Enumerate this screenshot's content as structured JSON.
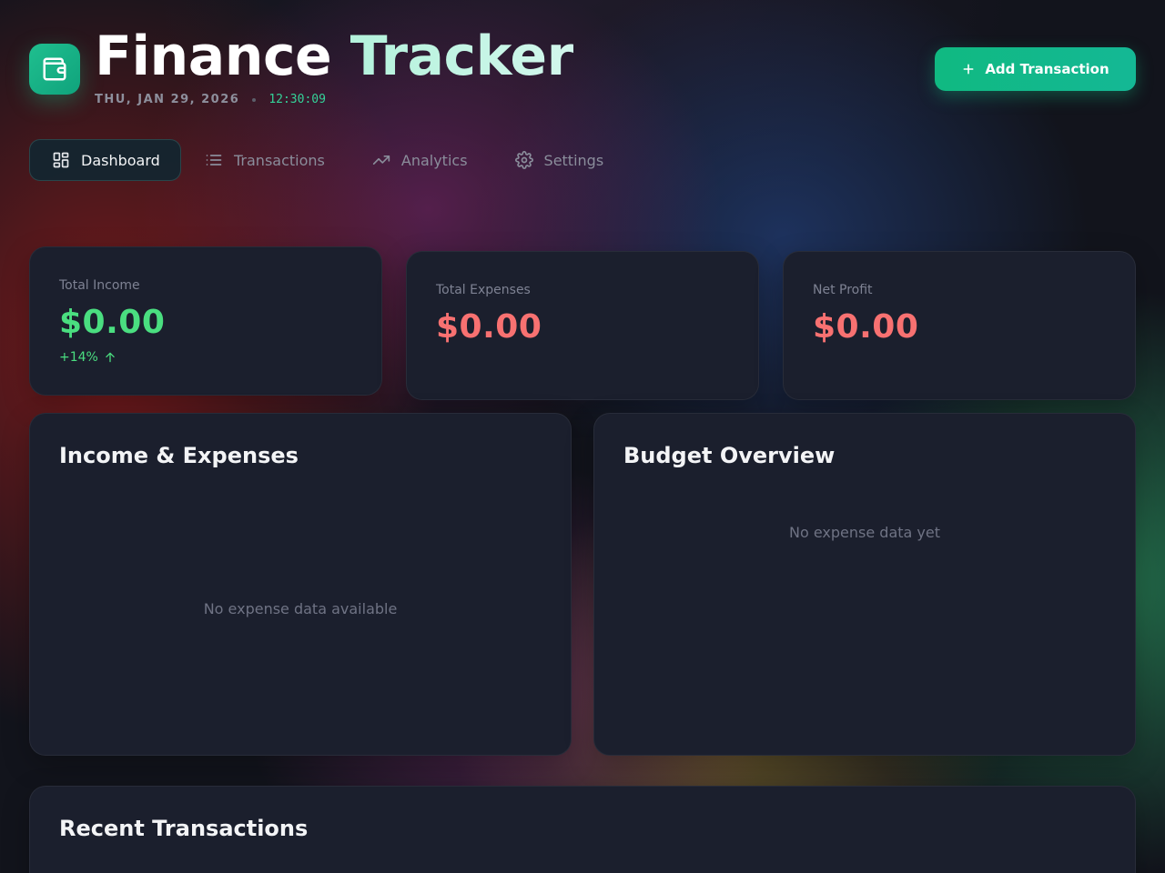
{
  "app": {
    "title_part1": "Finance",
    "title_part2": "Tracker",
    "date": "THU, JAN 29, 2026",
    "time": "12:30:09",
    "logo_icon": "wallet-icon",
    "accent_color": "#10b981"
  },
  "header": {
    "add_button_label": "Add Transaction",
    "add_button_icon": "plus-icon"
  },
  "nav": {
    "items": [
      {
        "label": "Dashboard",
        "icon": "dashboard-icon",
        "active": true
      },
      {
        "label": "Transactions",
        "icon": "list-icon",
        "active": false
      },
      {
        "label": "Analytics",
        "icon": "trending-up-icon",
        "active": false
      },
      {
        "label": "Settings",
        "icon": "gear-icon",
        "active": false
      }
    ]
  },
  "stats": {
    "income": {
      "label": "Total Income",
      "value": "$0.00",
      "trend": "+14%",
      "color": "#4ade80"
    },
    "expenses": {
      "label": "Total Expenses",
      "value": "$0.00",
      "color": "#f87171"
    },
    "profit": {
      "label": "Net Profit",
      "value": "$0.00",
      "color": "#f87171"
    }
  },
  "panels": {
    "income_expenses": {
      "title": "Income & Expenses",
      "empty_text": "No expense data available"
    },
    "budget": {
      "title": "Budget Overview",
      "empty_text": "No expense data yet"
    },
    "recent": {
      "title": "Recent Transactions"
    }
  }
}
